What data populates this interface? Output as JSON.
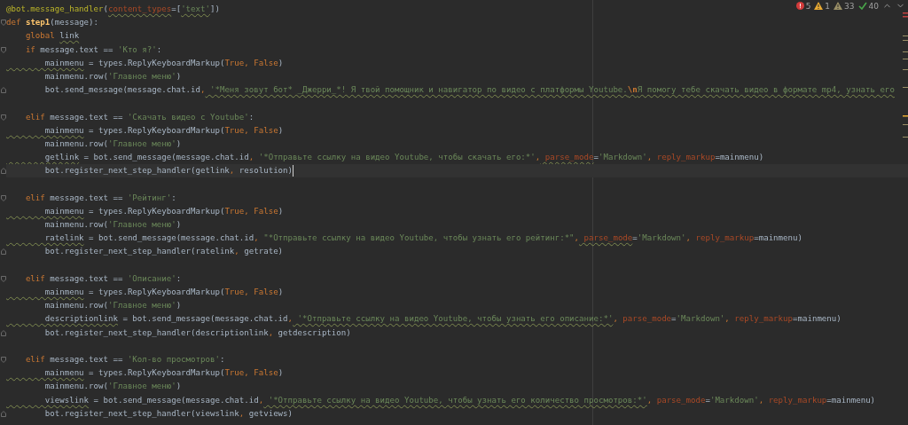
{
  "inspections": [
    {
      "kind": "error",
      "count": "5"
    },
    {
      "kind": "warning",
      "count": "1"
    },
    {
      "kind": "weak",
      "count": "33"
    },
    {
      "kind": "typo",
      "count": "40"
    }
  ],
  "lines": [
    {
      "kind": "code",
      "tokens": [
        {
          "t": "@bot.message_handler",
          "kind": "decorator"
        },
        {
          "t": "(",
          "kind": "plain"
        },
        {
          "t": "content_types",
          "kind": "param",
          "wavy": true
        },
        {
          "t": "=[",
          "kind": "plain"
        },
        {
          "t": "'text'",
          "kind": "string",
          "wavy": true
        },
        {
          "t": "])",
          "kind": "plain"
        }
      ]
    },
    {
      "kind": "code",
      "fold_start": true,
      "tokens": [
        {
          "t": "def ",
          "kind": "keyword"
        },
        {
          "t": "step1",
          "kind": "function"
        },
        {
          "t": "(message):",
          "kind": "plain"
        }
      ]
    },
    {
      "kind": "code",
      "tokens": [
        {
          "t": "    global ",
          "kind": "keyword"
        },
        {
          "t": "link",
          "kind": "plain",
          "wavy": true
        }
      ]
    },
    {
      "kind": "code",
      "fold_start": true,
      "tokens": [
        {
          "t": "    if",
          "kind": "keyword"
        },
        {
          "t": " message.text == ",
          "kind": "plain"
        },
        {
          "t": "'Кто я?'",
          "kind": "string"
        },
        {
          "t": ":",
          "kind": "plain"
        }
      ]
    },
    {
      "kind": "code",
      "tokens": [
        {
          "t": "        mainmenu",
          "kind": "plain",
          "wavy": true
        },
        {
          "t": " = types.ReplyKeyboardMarkup(",
          "kind": "plain"
        },
        {
          "t": "True, False",
          "kind": "keyword"
        },
        {
          "t": ")",
          "kind": "plain"
        }
      ]
    },
    {
      "kind": "code",
      "tokens": [
        {
          "t": "        mainmenu.row(",
          "kind": "plain"
        },
        {
          "t": "'Главное меню'",
          "kind": "string"
        },
        {
          "t": ")",
          "kind": "plain"
        }
      ]
    },
    {
      "kind": "code",
      "fold_end": true,
      "tokens": [
        {
          "t": "        bot.send_message(message.chat.id",
          "kind": "plain"
        },
        {
          "t": ",",
          "kind": "keyword"
        },
        {
          "t": " '*Меня зовут бот* _Джерри_*! Я твой помощник и навигатор по видео с платформы Youtube.",
          "kind": "string",
          "wavy": true
        },
        {
          "t": "\\n",
          "kind": "escape",
          "wavy": true
        },
        {
          "t": "Я помогу тебе скачать видео в формате mp4, узнать его",
          "kind": "string",
          "wavy": true
        }
      ]
    },
    {
      "kind": "blank"
    },
    {
      "kind": "code",
      "fold_start": true,
      "tokens": [
        {
          "t": "    elif",
          "kind": "keyword"
        },
        {
          "t": " message.text == ",
          "kind": "plain"
        },
        {
          "t": "'Скачать видео с Youtube'",
          "kind": "string"
        },
        {
          "t": ":",
          "kind": "plain"
        }
      ]
    },
    {
      "kind": "code",
      "tokens": [
        {
          "t": "        mainmenu",
          "kind": "plain",
          "wavy": true
        },
        {
          "t": " = types.ReplyKeyboardMarkup(",
          "kind": "plain"
        },
        {
          "t": "True, False",
          "kind": "keyword"
        },
        {
          "t": ")",
          "kind": "plain"
        }
      ]
    },
    {
      "kind": "code",
      "tokens": [
        {
          "t": "        mainmenu.row(",
          "kind": "plain"
        },
        {
          "t": "'Главное меню'",
          "kind": "string"
        },
        {
          "t": ")",
          "kind": "plain"
        }
      ]
    },
    {
      "kind": "code",
      "tokens": [
        {
          "t": "        getlink",
          "kind": "plain",
          "wavy": true
        },
        {
          "t": " = bot.send_message(message.chat.id",
          "kind": "plain"
        },
        {
          "t": ",",
          "kind": "keyword"
        },
        {
          "t": " '*Отправьте ссылку на видео Youtube, чтобы скачать его:*'",
          "kind": "string"
        },
        {
          "t": ",",
          "kind": "keyword"
        },
        {
          "t": " parse_mode",
          "kind": "param",
          "wavy": true
        },
        {
          "t": "=",
          "kind": "plain"
        },
        {
          "t": "'Markdown'",
          "kind": "string"
        },
        {
          "t": ",",
          "kind": "keyword"
        },
        {
          "t": " reply_markup",
          "kind": "param"
        },
        {
          "t": "=mainmenu)",
          "kind": "plain"
        }
      ]
    },
    {
      "kind": "code",
      "fold_end": true,
      "current": true,
      "tokens": [
        {
          "t": "        bot.register_next_step_handler(getlink",
          "kind": "plain"
        },
        {
          "t": ",",
          "kind": "keyword"
        },
        {
          "t": " resolution)",
          "kind": "plain"
        }
      ]
    },
    {
      "kind": "blank"
    },
    {
      "kind": "code",
      "fold_start": true,
      "tokens": [
        {
          "t": "    elif",
          "kind": "keyword"
        },
        {
          "t": " message.text == ",
          "kind": "plain"
        },
        {
          "t": "'Рейтинг'",
          "kind": "string"
        },
        {
          "t": ":",
          "kind": "plain"
        }
      ]
    },
    {
      "kind": "code",
      "tokens": [
        {
          "t": "        mainmenu",
          "kind": "plain",
          "wavy": true
        },
        {
          "t": " = types.ReplyKeyboardMarkup(",
          "kind": "plain"
        },
        {
          "t": "True, False",
          "kind": "keyword"
        },
        {
          "t": ")",
          "kind": "plain"
        }
      ]
    },
    {
      "kind": "code",
      "tokens": [
        {
          "t": "        mainmenu.row(",
          "kind": "plain"
        },
        {
          "t": "'Главное меню'",
          "kind": "string"
        },
        {
          "t": ")",
          "kind": "plain"
        }
      ]
    },
    {
      "kind": "code",
      "tokens": [
        {
          "t": "        ratelink",
          "kind": "plain",
          "wavy": true
        },
        {
          "t": " = bot.send_message(message.chat.id",
          "kind": "plain"
        },
        {
          "t": ",",
          "kind": "keyword"
        },
        {
          "t": " \"*Отправьте ссылку на видео Youtube, чтобы узнать его рейтинг:*\"",
          "kind": "string"
        },
        {
          "t": ",",
          "kind": "keyword"
        },
        {
          "t": " parse_mode",
          "kind": "param",
          "wavy": true
        },
        {
          "t": "=",
          "kind": "plain"
        },
        {
          "t": "'Markdown'",
          "kind": "string"
        },
        {
          "t": ",",
          "kind": "keyword"
        },
        {
          "t": " reply_markup",
          "kind": "param"
        },
        {
          "t": "=mainmenu)",
          "kind": "plain"
        }
      ]
    },
    {
      "kind": "code",
      "fold_end": true,
      "tokens": [
        {
          "t": "        bot.register_next_step_handler(ratelink",
          "kind": "plain"
        },
        {
          "t": ",",
          "kind": "keyword"
        },
        {
          "t": " getrate)",
          "kind": "plain"
        }
      ]
    },
    {
      "kind": "blank"
    },
    {
      "kind": "code",
      "fold_start": true,
      "tokens": [
        {
          "t": "    elif",
          "kind": "keyword"
        },
        {
          "t": " message.text == ",
          "kind": "plain"
        },
        {
          "t": "'Описание'",
          "kind": "string"
        },
        {
          "t": ":",
          "kind": "plain"
        }
      ]
    },
    {
      "kind": "code",
      "tokens": [
        {
          "t": "        mainmenu",
          "kind": "plain",
          "wavy": true
        },
        {
          "t": " = types.ReplyKeyboardMarkup(",
          "kind": "plain"
        },
        {
          "t": "True, False",
          "kind": "keyword"
        },
        {
          "t": ")",
          "kind": "plain"
        }
      ]
    },
    {
      "kind": "code",
      "tokens": [
        {
          "t": "        mainmenu.row(",
          "kind": "plain"
        },
        {
          "t": "'Главное меню'",
          "kind": "string"
        },
        {
          "t": ")",
          "kind": "plain"
        }
      ]
    },
    {
      "kind": "code",
      "tokens": [
        {
          "t": "        descriptionlink",
          "kind": "plain",
          "wavy": true
        },
        {
          "t": " = bot.send_message(message.chat.id",
          "kind": "plain"
        },
        {
          "t": ",",
          "kind": "keyword"
        },
        {
          "t": " '*Отправьте ссылку на видео Youtube, чтобы узнать его описание:*'",
          "kind": "string",
          "wavy": true
        },
        {
          "t": ",",
          "kind": "keyword"
        },
        {
          "t": " parse_mode",
          "kind": "param"
        },
        {
          "t": "=",
          "kind": "plain"
        },
        {
          "t": "'Markdown'",
          "kind": "string"
        },
        {
          "t": ",",
          "kind": "keyword"
        },
        {
          "t": " reply_markup",
          "kind": "param"
        },
        {
          "t": "=mainmenu)",
          "kind": "plain"
        }
      ]
    },
    {
      "kind": "code",
      "fold_end": true,
      "tokens": [
        {
          "t": "        bot.register_next_step_handler(descriptionlink",
          "kind": "plain"
        },
        {
          "t": ",",
          "kind": "keyword"
        },
        {
          "t": " getdescription)",
          "kind": "plain"
        }
      ]
    },
    {
      "kind": "blank"
    },
    {
      "kind": "code",
      "fold_start": true,
      "tokens": [
        {
          "t": "    elif",
          "kind": "keyword"
        },
        {
          "t": " message.text == ",
          "kind": "plain"
        },
        {
          "t": "'Кол-во просмотров'",
          "kind": "string"
        },
        {
          "t": ":",
          "kind": "plain"
        }
      ]
    },
    {
      "kind": "code",
      "tokens": [
        {
          "t": "        mainmenu",
          "kind": "plain",
          "wavy": true
        },
        {
          "t": " = types.ReplyKeyboardMarkup(",
          "kind": "plain"
        },
        {
          "t": "True, False",
          "kind": "keyword"
        },
        {
          "t": ")",
          "kind": "plain"
        }
      ]
    },
    {
      "kind": "code",
      "tokens": [
        {
          "t": "        mainmenu.row(",
          "kind": "plain"
        },
        {
          "t": "'Главное меню'",
          "kind": "string"
        },
        {
          "t": ")",
          "kind": "plain"
        }
      ]
    },
    {
      "kind": "code",
      "tokens": [
        {
          "t": "        viewslink",
          "kind": "plain",
          "wavy": true
        },
        {
          "t": " = bot.send_message(message.chat.id",
          "kind": "plain"
        },
        {
          "t": ",",
          "kind": "keyword"
        },
        {
          "t": " '*Отправьте ссылку на видео Youtube, чтобы узнать его количество просмотров:*'",
          "kind": "string",
          "wavy": true
        },
        {
          "t": ",",
          "kind": "keyword"
        },
        {
          "t": " parse_mode",
          "kind": "param"
        },
        {
          "t": "=",
          "kind": "plain"
        },
        {
          "t": "'Markdown'",
          "kind": "string"
        },
        {
          "t": ",",
          "kind": "keyword"
        },
        {
          "t": " reply_markup",
          "kind": "param"
        },
        {
          "t": "=mainmenu)",
          "kind": "plain"
        }
      ]
    },
    {
      "kind": "code",
      "fold_end": true,
      "tokens": [
        {
          "t": "        bot.register_next_step_handler(viewslink",
          "kind": "plain"
        },
        {
          "t": ",",
          "kind": "keyword"
        },
        {
          "t": " getviews)",
          "kind": "plain"
        }
      ]
    }
  ]
}
